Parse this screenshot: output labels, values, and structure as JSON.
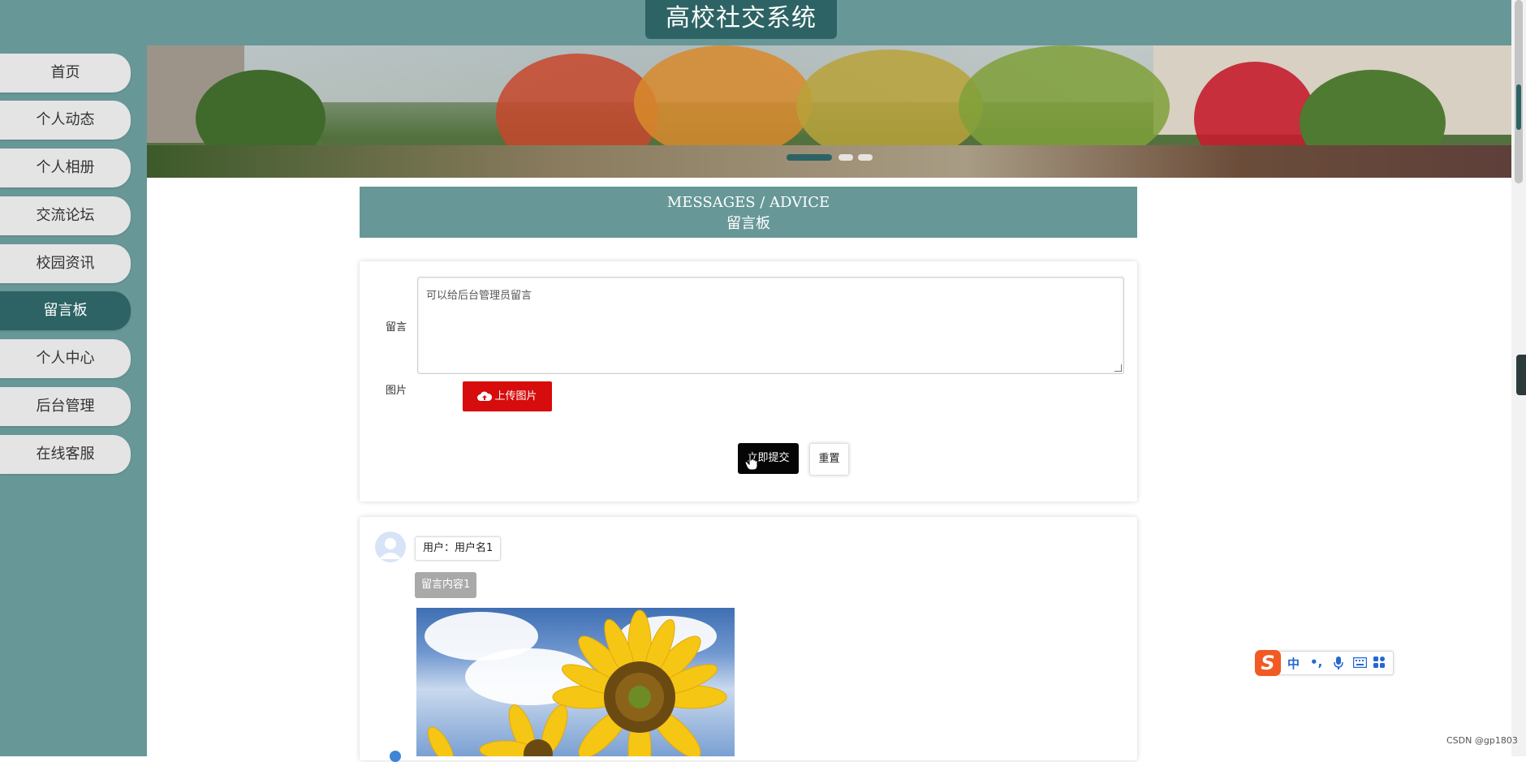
{
  "header": {
    "site_title": "高校社交系统"
  },
  "sidebar": {
    "items": [
      {
        "label": "首页"
      },
      {
        "label": "个人动态"
      },
      {
        "label": "个人相册"
      },
      {
        "label": "交流论坛"
      },
      {
        "label": "校园资讯"
      },
      {
        "label": "留言板",
        "active": true
      },
      {
        "label": "个人中心"
      },
      {
        "label": "后台管理"
      },
      {
        "label": "在线客服"
      }
    ]
  },
  "banner": {
    "slide_count": 3,
    "active_slide": 1
  },
  "section": {
    "title_en": "MESSAGES / ADVICE",
    "title_cn": "留言板"
  },
  "form": {
    "message_label": "留言",
    "message_placeholder": "可以给后台管理员留言",
    "image_label": "图片",
    "upload_label": "上传图片",
    "submit_label": "立即提交",
    "reset_label": "重置"
  },
  "messages": [
    {
      "user": "用户：用户名1",
      "content": "留言内容1",
      "has_image": true
    }
  ],
  "ime": {
    "mode": "中",
    "punct": "•,"
  },
  "watermark": "CSDN @gp1803",
  "colors": {
    "theme": "#689797",
    "theme_dark": "#2d6364",
    "upload": "#d70c0c",
    "submit": "#050505"
  }
}
